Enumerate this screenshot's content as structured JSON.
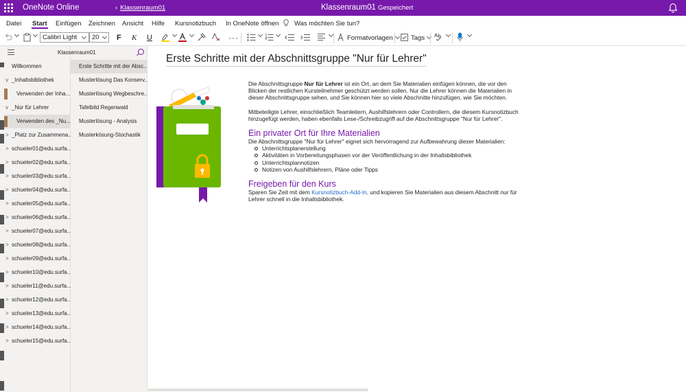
{
  "titlebar": {
    "app_name": "OneNote Online",
    "breadcrumb_arrow": "›",
    "notebook_link": "Klassenraum01",
    "notebook_name": "Klassenraum01",
    "separator": "-",
    "status": "Gespeichert"
  },
  "menu": {
    "items": [
      "Datei",
      "Start",
      "Einfügen",
      "Zeichnen",
      "Ansicht",
      "Hilfe",
      "Kursnotizbuch",
      "In OneNote öffnen"
    ],
    "active": "Start",
    "tell_me": "Was möchten Sie tun?"
  },
  "ribbon": {
    "font_name": "Calibri Light",
    "font_size": "20",
    "bold": "F",
    "italic": "K",
    "underline": "U",
    "more": "···",
    "styles": "Formatvorlagen",
    "tags": "Tags",
    "accent_color": "#7719aa",
    "highlight_color": "#ffd400",
    "font_color": "#c50f1f"
  },
  "nav": {
    "notebook_title": "Klassenraum01",
    "sections": [
      {
        "label": "Willkommen",
        "expander": ""
      },
      {
        "label": "_Inhaltsbibliothek",
        "expander": "v"
      },
      {
        "label": "Verwenden der Inha...",
        "expander": ""
      },
      {
        "label": "_Nur für Lehrer",
        "expander": "v"
      },
      {
        "label": "Verwenden des _Nu...",
        "expander": ""
      },
      {
        "label": "_Platz zur Zusammena...",
        "expander": ">"
      },
      {
        "label": "schueler01@edu.surfa...",
        "expander": ">"
      },
      {
        "label": "schueler02@edu.surfa...",
        "expander": ">"
      },
      {
        "label": "schueler03@edu.surfa...",
        "expander": ">"
      },
      {
        "label": "schueler04@edu.surfa...",
        "expander": ">"
      },
      {
        "label": "schueler05@edu.surfa...",
        "expander": ">"
      },
      {
        "label": "schueler06@edu.surfa...",
        "expander": ">"
      },
      {
        "label": "schueler07@edu.surfa...",
        "expander": ">"
      },
      {
        "label": "schueler08@edu.surfa...",
        "expander": ">"
      },
      {
        "label": "schueler09@edu.surfa...",
        "expander": ">"
      },
      {
        "label": "schueler10@edu.surfa...",
        "expander": ">"
      },
      {
        "label": "schueler11@edu.surfa...",
        "expander": ">"
      },
      {
        "label": "schueler12@edu.surfa...",
        "expander": ">"
      },
      {
        "label": "schueler13@edu.surfa...",
        "expander": ">"
      },
      {
        "label": "schueler14@edu.surfa...",
        "expander": ">"
      },
      {
        "label": "schueler15@edu.surfa...",
        "expander": ">"
      }
    ],
    "pages": [
      "Erste Schritte mit der Absc...",
      "Musterlösung Das Konserv...",
      "Musterlösung Wegbeschre...",
      "Tafelbild Regenwald",
      "Musterlösung - Analysis",
      "Musterkösung-Stochastik"
    ]
  },
  "page": {
    "title": "Erste Schritte mit der Abschnittsgruppe \"Nur für Lehrer\"",
    "intro_pre": "Die Abschnittsgruppe ",
    "intro_bold": "Nur für Lehrer",
    "intro_post": " ist ein Ort, an dem Sie Materialien einfügen können, die vor den Blicken der restlichen Kursteilnehmer geschützt werden sollen. Nur die Lehrer können die Materialien in dieser Abschnittsgruppe sehen, und Sie können hier so viele Abschnitte hinzufügen, wie Sie möchten.",
    "para2": "Mitbeteiligte Lehrer, einschließlich Teamleitern, Aushilfslehrern oder Controllern, die diesem Kursnotizbuch hinzugefügt werden, haben ebenfalls Lese-/Schreibzugriff auf die Abschnittsgruppe \"Nur für Lehrer\".",
    "heading1": "Ein privater Ort für Ihre Materialien",
    "para3": "Die Abschnittsgruppe \"Nur für Lehrer\" eignet sich hervorragend zur Aufbewahrung dieser Materialien:",
    "bullets": [
      "Unterrichtsplanerstellung",
      "Aktivitäten in Vorbereitungsphasen vor der Veröffentlichung in der Inhaltsbibliothek",
      "Unterrichtsplannotizen",
      "Notizen von Aushilfslehrern, Pläne oder Tipps"
    ],
    "heading2": "Freigeben für den Kurs",
    "para4_pre": "Sparen Sie Zeit mit dem ",
    "para4_link": "Kursnotizbuch-Add-In",
    "para4_post": ", und kopieren Sie Materialien aus diesem Abschnitt nur für Lehrer schnell in die Inhaltsbibliothek."
  }
}
